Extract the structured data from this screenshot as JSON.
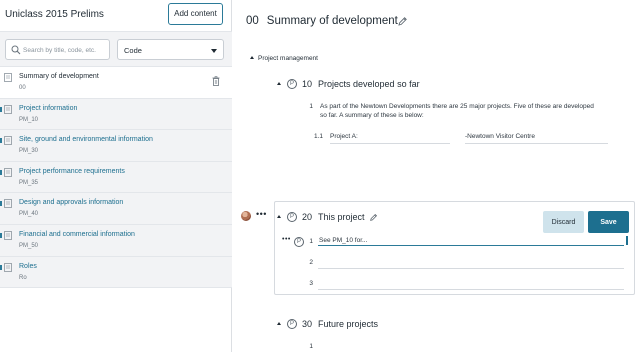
{
  "sidebar": {
    "title": "Uniclass 2015 Prelims",
    "add_button": "Add content",
    "search_placeholder": "Search by title, code, etc.",
    "code_select": "Code",
    "items": [
      {
        "name": "Summary of development",
        "code": "00"
      },
      {
        "name": "Project information",
        "code": "PM_10"
      },
      {
        "name": "Site, ground and environmental information",
        "code": "PM_30"
      },
      {
        "name": "Project performance requirements",
        "code": "PM_35"
      },
      {
        "name": "Design and approvals information",
        "code": "PM_40"
      },
      {
        "name": "Financial and commercial information",
        "code": "PM_50"
      },
      {
        "name": "Roles",
        "code": "Ro"
      }
    ]
  },
  "main": {
    "page_title_num": "00",
    "page_title": "Summary of development",
    "section": "Project management",
    "clauses": [
      {
        "badge": "P",
        "num": "10",
        "title": "Projects developed so far",
        "line1_num": "1",
        "line1_text_a": "As part of the Newtown Developments there are 25 major projects. Five of these are developed",
        "line1_text_b": "so far. A summary of these is below:",
        "sub_num": "1.1",
        "sub_label": "Project A:",
        "sub_value": "-Newtown Visitor Centre"
      },
      {
        "badge": "P",
        "num": "20",
        "title": "This project",
        "line1_num": "1",
        "line1_value": "See PM_10 for...",
        "line2_num": "2",
        "line3_num": "3",
        "discard": "Discard",
        "save": "Save"
      },
      {
        "badge": "P",
        "num": "30",
        "title": "Future projects",
        "line1_num": "1"
      }
    ],
    "dots": "•••"
  },
  "colors": {
    "accent": "#1d6f8f",
    "sidebar_bg": "#f2f3f5",
    "discard_bg": "#cfe3ec"
  }
}
